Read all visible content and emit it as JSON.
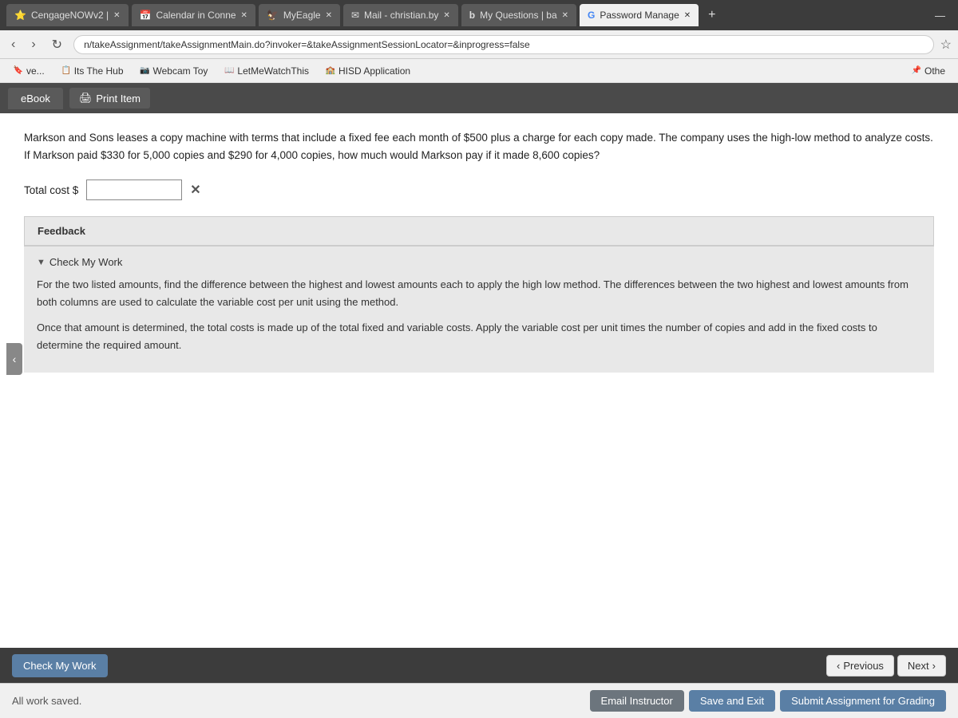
{
  "browser": {
    "tabs": [
      {
        "id": "cengage",
        "label": "CengageNOWv2 |",
        "active": false,
        "icon": "⭐"
      },
      {
        "id": "calendar",
        "label": "Calendar in Conne",
        "active": false,
        "icon": "📅"
      },
      {
        "id": "myeagle",
        "label": "MyEagle",
        "active": false,
        "icon": "🦅"
      },
      {
        "id": "mail",
        "label": "Mail - christian.by",
        "active": false,
        "icon": "✉"
      },
      {
        "id": "myquestions",
        "label": "My Questions | ba",
        "active": false,
        "icon": "b"
      },
      {
        "id": "password",
        "label": "Password Manage",
        "active": true,
        "icon": "G"
      }
    ],
    "address": "n/takeAssignment/takeAssignmentMain.do?invoker=&takeAssignmentSessionLocator=&inprogress=false",
    "add_tab": "+",
    "minimize": "—"
  },
  "bookmarks": [
    {
      "label": "ve...",
      "icon": "🔖"
    },
    {
      "label": "Its The Hub",
      "icon": "📋"
    },
    {
      "label": "Webcam Toy",
      "icon": "📷"
    },
    {
      "label": "LetMeWatchThis",
      "icon": "📖"
    },
    {
      "label": "HISD Application",
      "icon": "🏫"
    },
    {
      "label": "Othe",
      "icon": "📌"
    }
  ],
  "toolbar": {
    "ebook_label": "eBook",
    "print_label": "Print Item"
  },
  "question": {
    "text": "Markson and Sons leases a copy machine with terms that include a fixed fee each month of $500 plus a charge for each copy made. The company uses the high-low method to analyze costs. If Markson paid $330 for 5,000 copies and $290 for 4,000 copies, how much would Markson pay if it made 8,600 copies?",
    "answer_label": "Total cost $",
    "answer_placeholder": "",
    "answer_value": ""
  },
  "feedback": {
    "label": "Feedback",
    "check_my_work_toggle": "Check My Work",
    "paragraph1": "For the two listed amounts, find the difference between the highest and lowest amounts each to apply the high low method. The differences between the two highest and lowest amounts from both columns are used to calculate the variable cost per unit using the method.",
    "paragraph2": "Once that amount is determined, the total costs is made up of the total fixed and variable costs. Apply the variable cost per unit times the number of copies and add in the fixed costs to determine the required amount."
  },
  "bottom": {
    "check_work_label": "Check My Work",
    "all_work_saved": "All work saved.",
    "prev_label": "Previous",
    "next_label": "Next",
    "email_instructor_label": "Email Instructor",
    "save_exit_label": "Save and Exit",
    "submit_label": "Submit Assignment for Grading"
  }
}
